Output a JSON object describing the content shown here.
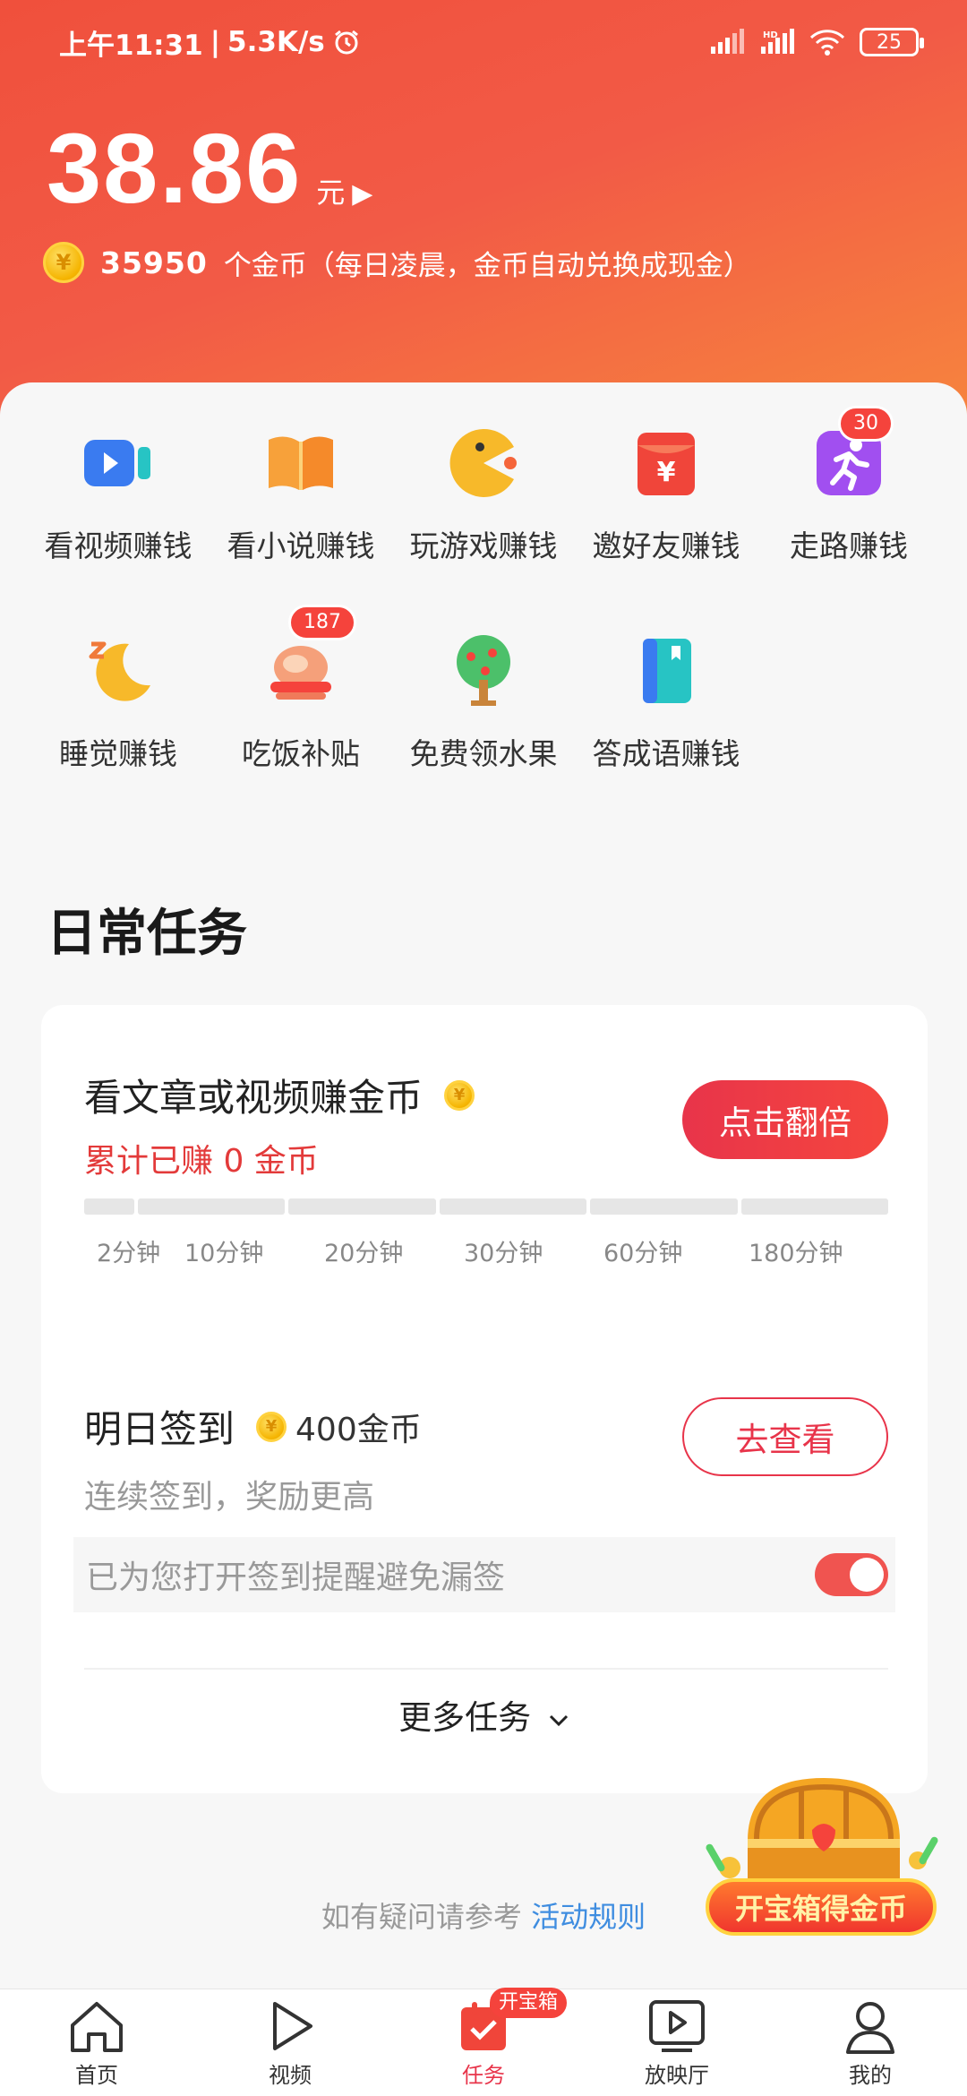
{
  "status_bar": {
    "time": "上午11:31",
    "speed": "5.3K/s",
    "battery": "25"
  },
  "balance": {
    "amount": "38.86",
    "unit": "元",
    "coins": "35950",
    "coin_text": "个金币（每日凌晨，金币自动兑换成现金）"
  },
  "grid": [
    {
      "label": "看视频赚钱",
      "icon": "video-icon"
    },
    {
      "label": "看小说赚钱",
      "icon": "book-icon"
    },
    {
      "label": "玩游戏赚钱",
      "icon": "pacman-icon"
    },
    {
      "label": "邀好友赚钱",
      "icon": "red-envelope-icon"
    },
    {
      "label": "走路赚钱",
      "icon": "running-icon",
      "badge": "30"
    },
    {
      "label": "睡觉赚钱",
      "icon": "moon-icon"
    },
    {
      "label": "吃饭补贴",
      "icon": "chicken-icon",
      "badge": "187"
    },
    {
      "label": "免费领水果",
      "icon": "fruit-tree-icon"
    },
    {
      "label": "答成语赚钱",
      "icon": "idiom-book-icon"
    }
  ],
  "section_title": "日常任务",
  "task_read": {
    "title": "看文章或视频赚金币",
    "earned": "累计已赚 0 金币",
    "button": "点击翻倍",
    "ticks": [
      "2分钟",
      "10分钟",
      "20分钟",
      "30分钟",
      "60分钟",
      "180分钟"
    ],
    "progress": 0
  },
  "task_signin": {
    "title": "明日签到",
    "reward": "400金币",
    "subtitle": "连续签到，奖励更高",
    "button": "去查看",
    "reminder": "已为您打开签到提醒避免漏签",
    "reminder_on": true
  },
  "more_tasks": "更多任务",
  "rules": {
    "prefix": "如有疑问请参考",
    "link": "活动规则"
  },
  "treasure": {
    "label": "开宝箱得金币"
  },
  "tabbar": [
    {
      "label": "首页",
      "icon": "home-icon"
    },
    {
      "label": "视频",
      "icon": "play-icon"
    },
    {
      "label": "任务",
      "icon": "task-icon",
      "badge": "开宝箱",
      "active": true
    },
    {
      "label": "放映厅",
      "icon": "theater-icon"
    },
    {
      "label": "我的",
      "icon": "profile-icon"
    }
  ],
  "colors": {
    "header_start": "#f0503c",
    "header_end": "#f7893d",
    "accent_red": "#e8344a",
    "link_blue": "#3f8de0"
  }
}
